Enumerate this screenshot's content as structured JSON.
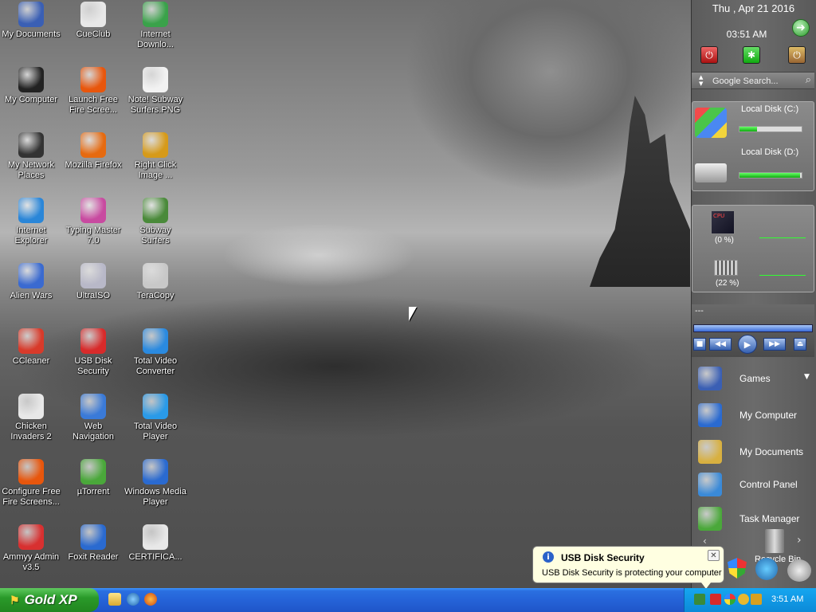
{
  "desktop": {
    "icons": [
      {
        "label": "My Documents",
        "icon": "my-documents-icon",
        "color": "#3a5fb4"
      },
      {
        "label": "CueClub",
        "icon": "cueclub-icon",
        "color": "#e8e8e8"
      },
      {
        "label": "Internet\nDownlo...",
        "icon": "internet-download-manager-icon",
        "color": "#3aa24a"
      },
      {
        "label": "My Computer",
        "icon": "my-computer-icon",
        "color": "#222222"
      },
      {
        "label": "Launch Free\nFire Scree...",
        "icon": "fire-screensaver-icon",
        "color": "#e8560c"
      },
      {
        "label": "Note! Subway\nSurfers.PNG",
        "icon": "png-file-icon",
        "color": "#f2f2f2"
      },
      {
        "label": "My Network\nPlaces",
        "icon": "network-places-icon",
        "color": "#333333"
      },
      {
        "label": "Mozilla Firefox",
        "icon": "firefox-icon",
        "color": "#e66a10"
      },
      {
        "label": "Right Click\nImage ...",
        "icon": "right-click-image-icon",
        "color": "#d69a1a"
      },
      {
        "label": "Internet\nExplorer",
        "icon": "internet-explorer-icon",
        "color": "#2a86d8"
      },
      {
        "label": "Typing Master\n7.0",
        "icon": "typing-master-icon",
        "color": "#c84aa0"
      },
      {
        "label": "Subway\nSurfers",
        "icon": "subway-surfers-icon",
        "color": "#4a8a3a"
      },
      {
        "label": "Alien Wars",
        "icon": "alien-wars-icon",
        "color": "#3a6ad0"
      },
      {
        "label": "UltraISO",
        "icon": "ultraiso-icon",
        "color": "#b8b8c8"
      },
      {
        "label": "TeraCopy",
        "icon": "teracopy-icon",
        "color": "#c8c8c8"
      },
      {
        "label": "CCleaner",
        "icon": "ccleaner-icon",
        "color": "#d83a2a"
      },
      {
        "label": "USB Disk\nSecurity",
        "icon": "usb-disk-security-icon",
        "color": "#d82a2a"
      },
      {
        "label": "Total Video\nConverter",
        "icon": "total-video-converter-icon",
        "color": "#2a8ae0"
      },
      {
        "label": "Chicken\nInvaders 2",
        "icon": "chicken-invaders-icon",
        "color": "#e8e8e8"
      },
      {
        "label": "Web\nNavigation",
        "icon": "web-navigation-icon",
        "color": "#3a7ad8"
      },
      {
        "label": "Total Video\nPlayer",
        "icon": "total-video-player-icon",
        "color": "#2a9ae8"
      },
      {
        "label": "Configure Free\nFire Screens...",
        "icon": "configure-fire-screensaver-icon",
        "color": "#e8560c"
      },
      {
        "label": "µTorrent",
        "icon": "utorrent-icon",
        "color": "#4aa83a"
      },
      {
        "label": "Windows Media\nPlayer",
        "icon": "windows-media-player-icon",
        "color": "#2a6ad0"
      },
      {
        "label": "Ammyy Admin\nv3.5",
        "icon": "ammyy-admin-icon",
        "color": "#d83030"
      },
      {
        "label": "Foxit Reader",
        "icon": "foxit-reader-icon",
        "color": "#2a6ad0"
      },
      {
        "label": "CERTIFICA...",
        "icon": "pdf-file-icon",
        "color": "#e8e8e8"
      }
    ]
  },
  "sidebar": {
    "date": "Thu , Apr 21 2016",
    "time": "03:51 AM",
    "search_placeholder": "Google Search...",
    "disks": [
      {
        "label": "Local Disk (C:)",
        "fill": 0.28
      },
      {
        "label": "Local Disk (D:)",
        "fill": 0.97
      }
    ],
    "cpu_pct": "(0 %)",
    "mem_pct": "(22 %)",
    "media_title": "---",
    "launch": [
      {
        "label": "Games",
        "icon": "games-folder-icon",
        "color": "#3a5fb4"
      },
      {
        "label": "My Computer",
        "icon": "my-computer-icon",
        "color": "#2a6ad0"
      },
      {
        "label": "My Documents",
        "icon": "my-documents-folder-icon",
        "color": "#d8b040"
      },
      {
        "label": "Control Panel",
        "icon": "control-panel-icon",
        "color": "#3a8ad8"
      },
      {
        "label": "Task Manager",
        "icon": "task-manager-icon",
        "color": "#4aa83a"
      }
    ],
    "recycle_label": "Recycle Bin"
  },
  "balloon": {
    "title": "USB Disk Security",
    "message": "USB Disk Security is protecting your computer"
  },
  "taskbar": {
    "start_label": "Gold XP",
    "clock": "3:51 AM"
  }
}
